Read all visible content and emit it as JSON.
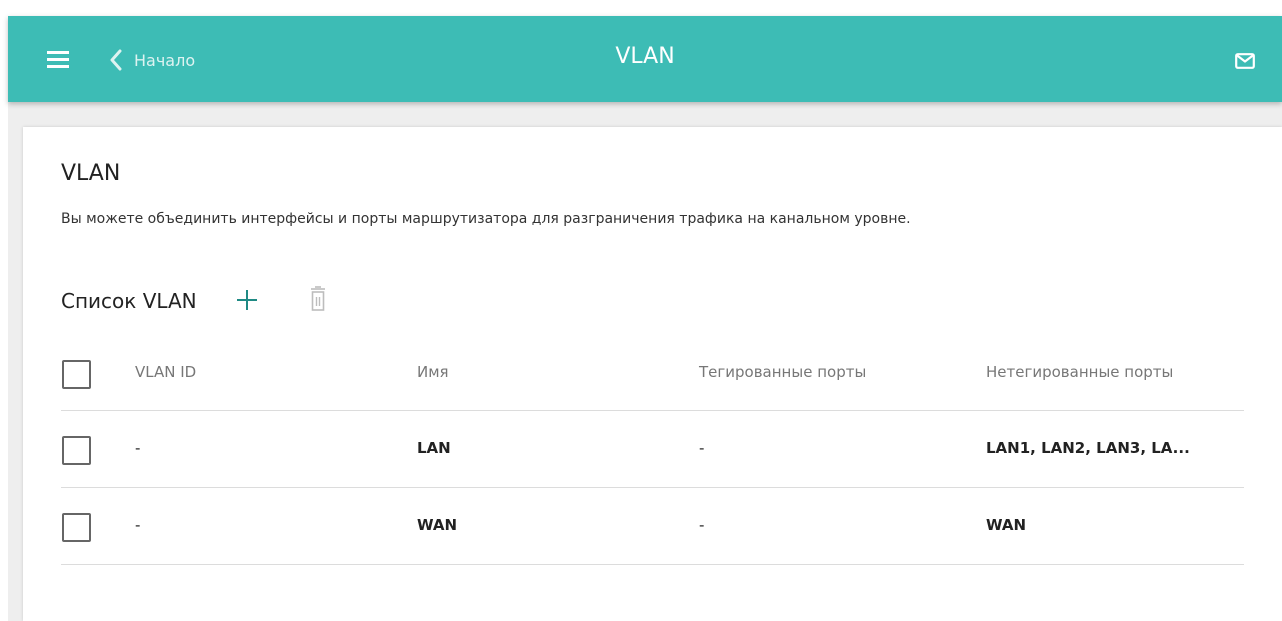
{
  "header": {
    "back_label": "Начало",
    "title": "VLAN",
    "menu_icon": "hamburger-menu-icon",
    "back_icon": "chevron-left-icon",
    "mail_icon": "envelope-icon"
  },
  "card": {
    "title": "VLAN",
    "description": "Вы можете объединить интерфейсы и порты маршрутизатора для разграничения трафика на канальном уровне."
  },
  "vlan_list": {
    "title": "Список VLAN",
    "add_icon": "plus-icon",
    "delete_icon": "trash-icon",
    "columns": [
      "VLAN ID",
      "Имя",
      "Тегированные порты",
      "Нетегированные порты"
    ],
    "rows": [
      {
        "vlan_id": "-",
        "name": "LAN",
        "tagged": "-",
        "untagged": "LAN1, LAN2, LAN3, LA..."
      },
      {
        "vlan_id": "-",
        "name": "WAN",
        "tagged": "-",
        "untagged": "WAN"
      }
    ]
  },
  "colors": {
    "accent": "#3dbcb5",
    "add_icon": "#1f8a84",
    "disabled_icon": "#bdbdbd",
    "background": "#eeeeee"
  }
}
